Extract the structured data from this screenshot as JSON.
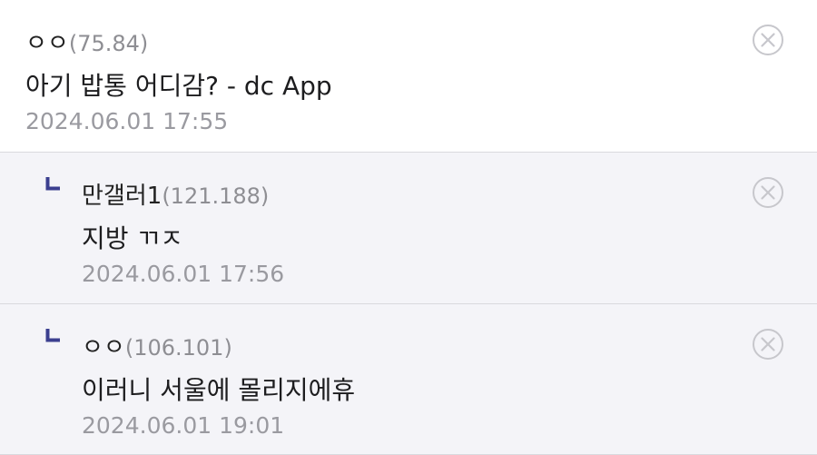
{
  "comments": [
    {
      "nickname": "ㅇㅇ",
      "ip": "(75.84)",
      "text": "아기 밥통 어디감? - dc App",
      "date": "2024.06.01 17:55"
    },
    {
      "nickname": "만갤러1",
      "ip": "(121.188)",
      "text": "지방 ㄲㅈ",
      "date": "2024.06.01 17:56"
    },
    {
      "nickname": "ㅇㅇ",
      "ip": "(106.101)",
      "text": "이러니 서울에 몰리지에휴",
      "date": "2024.06.01 19:01"
    }
  ],
  "colors": {
    "reply_bg": "#f4f4f8",
    "reply_marker": "#3b3f8f",
    "divider": "#d9d9de",
    "meta_gray": "#9a9aa0"
  },
  "icons": {
    "reply": "reply-corner-icon",
    "delete": "circle-x-icon"
  }
}
